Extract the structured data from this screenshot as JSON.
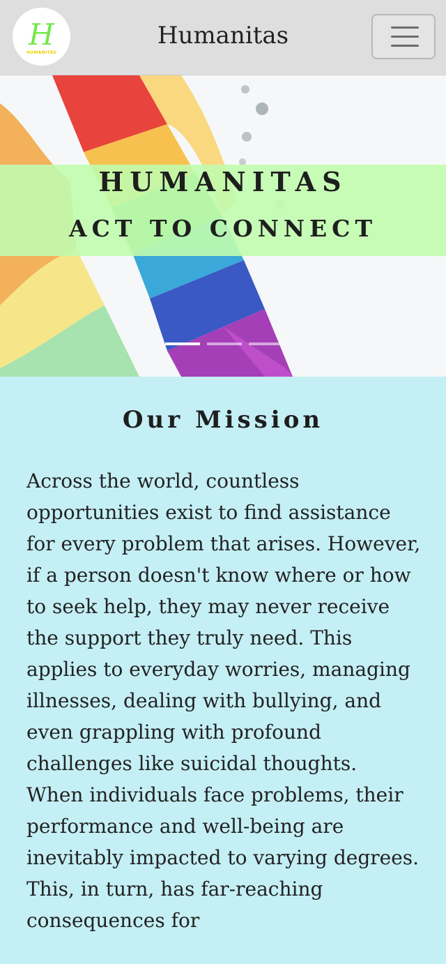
{
  "navbar": {
    "brand_title": "Humanitas",
    "logo": {
      "letter": "H",
      "word": "HUMANITAS"
    },
    "menu_icon": "hamburger-icon"
  },
  "hero": {
    "title": "HUMANITAS",
    "subtitle": "ACT TO CONNECT",
    "slides": 3,
    "active_slide": 1
  },
  "mission": {
    "heading": "Our Mission",
    "paragraph_1": "Across the world, countless opportunities exist to find assistance for every problem that arises. However, if a person doesn't know where or how to seek help, they may never receive the support they truly need. This applies to everyday worries, managing illnesses, dealing with bullying, and even grappling with profound challenges like suicidal thoughts.",
    "paragraph_2": "When individuals face problems, their performance and well-being are inevitably impacted to varying degrees. This, in turn, has far-reaching consequences for"
  },
  "colors": {
    "navbar_bg": "#dedede",
    "hero_band": "#c1fcae",
    "mission_bg": "#c4eff5",
    "logo_green": "#72e84a",
    "logo_yellow": "#f0d000"
  }
}
